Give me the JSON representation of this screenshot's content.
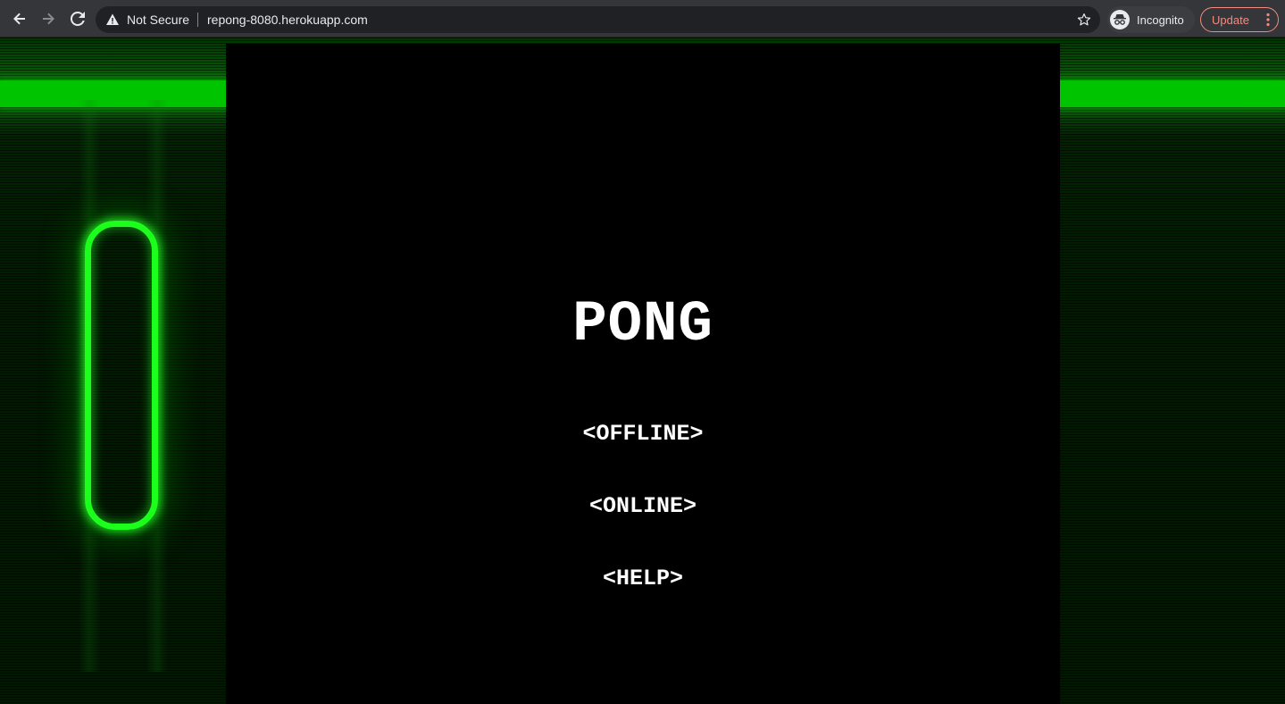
{
  "browser": {
    "security_label": "Not Secure",
    "url": "repong-8080.herokuapp.com",
    "profile_label": "Incognito",
    "update_label": "Update",
    "icons": {
      "back": "back-arrow-icon",
      "forward": "forward-arrow-icon",
      "reload": "reload-icon",
      "warning": "warning-icon",
      "bookmark": "star-icon",
      "incognito": "incognito-icon",
      "menu": "kebab-menu-icon"
    }
  },
  "game": {
    "title": "PONG",
    "menu": [
      "<OFFLINE>",
      "<ONLINE>",
      "<HELP>"
    ],
    "colors": {
      "neon_green": "#1cff1c",
      "band_green": "#00c400",
      "screen_bg": "#000000",
      "text": "#ffffff"
    }
  }
}
